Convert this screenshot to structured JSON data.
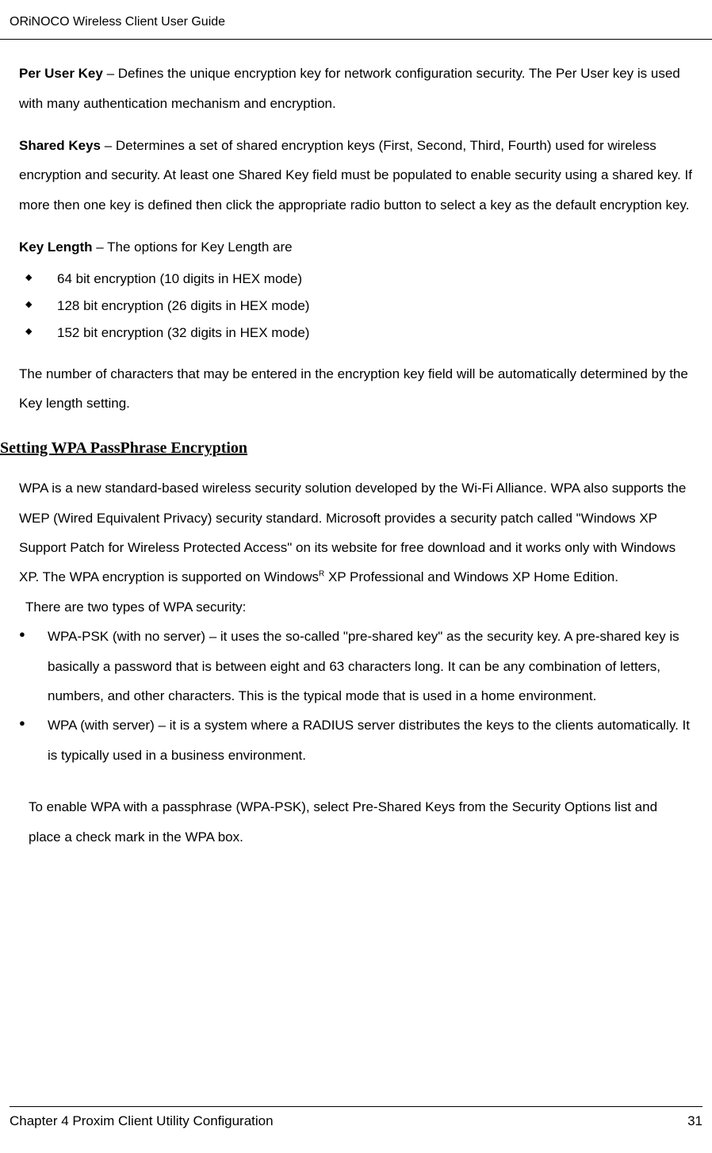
{
  "header": {
    "title": "ORiNOCO Wireless Client User Guide"
  },
  "body": {
    "perUserKey": {
      "label": "Per User Key",
      "text": " – Defines the unique encryption key for network configuration security. The Per User key is used with many authentication mechanism and encryption."
    },
    "sharedKeys": {
      "label": "Shared Keys",
      "text": " – Determines a set of shared encryption keys (First, Second, Third, Fourth) used for wireless encryption and security. At least one Shared Key field must be populated to enable security using a shared key. If more then one key is defined then click the appropriate radio button to select a key as the default encryption key."
    },
    "keyLength": {
      "label": "Key Length",
      "text": " – The options for Key Length are"
    },
    "keyLengthItems": [
      "64 bit encryption (10 digits in HEX mode)",
      "128 bit encryption (26 digits in HEX mode)",
      "152 bit encryption (32 digits in HEX mode)"
    ],
    "afterKeyLength": "The number of characters that may be entered in the encryption key field will be automatically determined by the Key length setting.",
    "sectionHeading": "Setting WPA PassPhrase Encryption",
    "wpaIntroPart1": "WPA is a new standard-based wireless security solution developed by the Wi-Fi Alliance. WPA also supports the WEP (Wired Equivalent Privacy) security standard. Microsoft provides a security patch called \"Windows XP Support Patch for Wireless Protected Access\" on its website for free download and it works only with Windows XP. The WPA encryption is supported on Windows",
    "wpaIntroSup": "R",
    "wpaIntroPart2": " XP Professional and Windows XP Home Edition.",
    "wpaTypesIntro": "There are two types of WPA security:",
    "wpaItems": [
      "WPA-PSK (with no server) – it uses the so-called \"pre-shared key\" as the security key. A pre-shared key is basically a password that is between eight and 63 characters long. It can be any combination of letters, numbers, and other characters. This is the typical mode that is used in a home environment.",
      "WPA  (with server) – it is a system where a RADIUS server distributes the keys to the clients automatically. It is typically used in a business environment."
    ],
    "finalPara": "To enable WPA with a passphrase (WPA-PSK), select Pre-Shared Keys from the Security Options list and place a check mark in the WPA box."
  },
  "footer": {
    "chapter": "Chapter 4 Proxim Client Utility Configuration",
    "pageNumber": "31"
  }
}
